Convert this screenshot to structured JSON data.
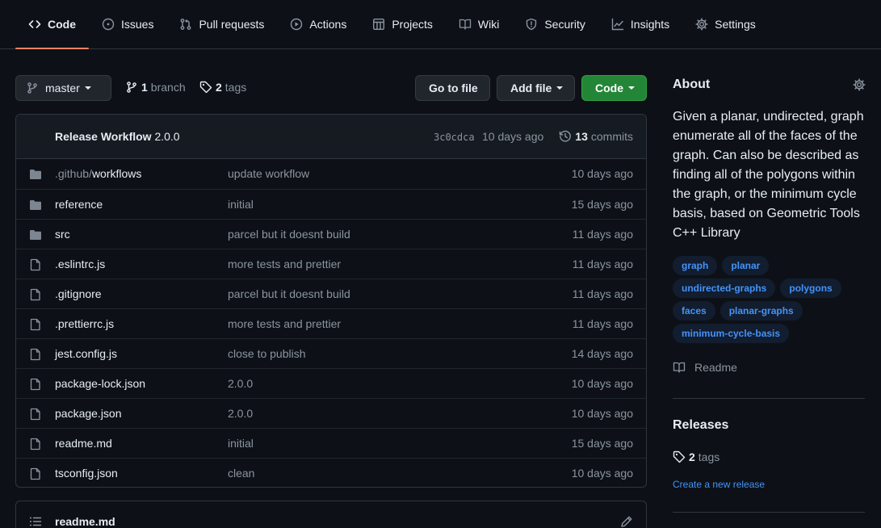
{
  "nav": {
    "tabs": [
      {
        "label": "Code",
        "icon": "code-icon",
        "active": true
      },
      {
        "label": "Issues",
        "icon": "issue-opened-icon"
      },
      {
        "label": "Pull requests",
        "icon": "git-pull-request-icon"
      },
      {
        "label": "Actions",
        "icon": "play-icon"
      },
      {
        "label": "Projects",
        "icon": "table-icon"
      },
      {
        "label": "Wiki",
        "icon": "book-icon"
      },
      {
        "label": "Security",
        "icon": "shield-icon"
      },
      {
        "label": "Insights",
        "icon": "graph-icon"
      },
      {
        "label": "Settings",
        "icon": "gear-icon"
      }
    ]
  },
  "toolbar": {
    "branch_name": "master",
    "branch_count": "1",
    "branch_label": "branch",
    "tag_count": "2",
    "tag_label": "tags",
    "goto_file": "Go to file",
    "add_file": "Add file",
    "code": "Code"
  },
  "commit": {
    "title": "Release Workflow",
    "version": "2.0.0",
    "sha": "3c0cdca",
    "date": "10 days ago",
    "count": "13",
    "count_label": "commits"
  },
  "files": [
    {
      "type": "dir",
      "name_dim": ".github/",
      "name": "workflows",
      "message": "update workflow",
      "age": "10 days ago"
    },
    {
      "type": "dir",
      "name_dim": "",
      "name": "reference",
      "message": "initial",
      "age": "15 days ago"
    },
    {
      "type": "dir",
      "name_dim": "",
      "name": "src",
      "message": "parcel but it doesnt build",
      "age": "11 days ago"
    },
    {
      "type": "file",
      "name_dim": "",
      "name": ".eslintrc.js",
      "message": "more tests and prettier",
      "age": "11 days ago"
    },
    {
      "type": "file",
      "name_dim": "",
      "name": ".gitignore",
      "message": "parcel but it doesnt build",
      "age": "11 days ago"
    },
    {
      "type": "file",
      "name_dim": "",
      "name": ".prettierrc.js",
      "message": "more tests and prettier",
      "age": "11 days ago"
    },
    {
      "type": "file",
      "name_dim": "",
      "name": "jest.config.js",
      "message": "close to publish",
      "age": "14 days ago"
    },
    {
      "type": "file",
      "name_dim": "",
      "name": "package-lock.json",
      "message": "2.0.0",
      "age": "10 days ago"
    },
    {
      "type": "file",
      "name_dim": "",
      "name": "package.json",
      "message": "2.0.0",
      "age": "10 days ago"
    },
    {
      "type": "file",
      "name_dim": "",
      "name": "readme.md",
      "message": "initial",
      "age": "15 days ago"
    },
    {
      "type": "file",
      "name_dim": "",
      "name": "tsconfig.json",
      "message": "clean",
      "age": "10 days ago"
    }
  ],
  "readme_box": {
    "title": "readme.md"
  },
  "about": {
    "title": "About",
    "description": "Given a planar, undirected, graph enumerate all of the faces of the graph. Can also be described as finding all of the polygons within the graph, or the minimum cycle basis, based on Geometric Tools C++ Library",
    "topics": [
      "graph",
      "planar",
      "undirected-graphs",
      "polygons",
      "faces",
      "planar-graphs",
      "minimum-cycle-basis"
    ],
    "readme_label": "Readme"
  },
  "releases": {
    "title": "Releases",
    "tag_count": "2",
    "tag_label": "tags",
    "create_link": "Create a new release"
  },
  "colors": {
    "background": "#0d1117",
    "border": "#30363d",
    "accent_tab": "#f78166",
    "green_button": "#238636",
    "link": "#4493f8",
    "muted": "#8b949e"
  }
}
